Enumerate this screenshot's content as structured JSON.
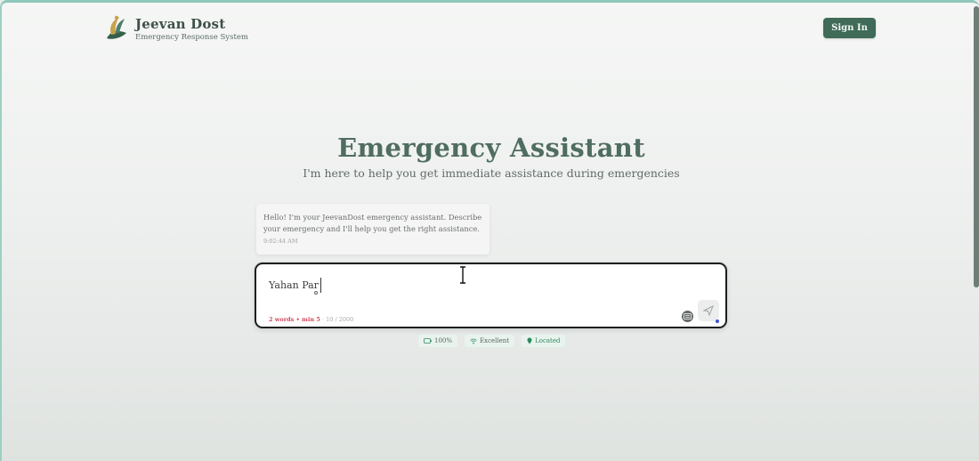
{
  "header": {
    "brand_name": "Jeevan Dost",
    "brand_tagline": "Emergency Response System",
    "signin_label": "Sign In"
  },
  "hero": {
    "title": "Emergency Assistant",
    "subtitle": "I'm here to help you get immediate assistance during emergencies"
  },
  "chat": {
    "messages": [
      {
        "text": "Hello! I'm your JeevanDost emergency assistant. Describe your emergency and I'll help you get the right assistance.",
        "time": "9:02:44 AM"
      }
    ]
  },
  "input": {
    "value": "Yahan Par",
    "word_warning": "2 words • min 5",
    "char_count": "· 10 / 2000"
  },
  "status": {
    "battery": "100%",
    "signal": "Excellent",
    "location": "Located"
  },
  "colors": {
    "brand": "#3f6b58",
    "title": "#4f6d60",
    "warning": "#d0485a",
    "accent_blue": "#3b55d6"
  }
}
